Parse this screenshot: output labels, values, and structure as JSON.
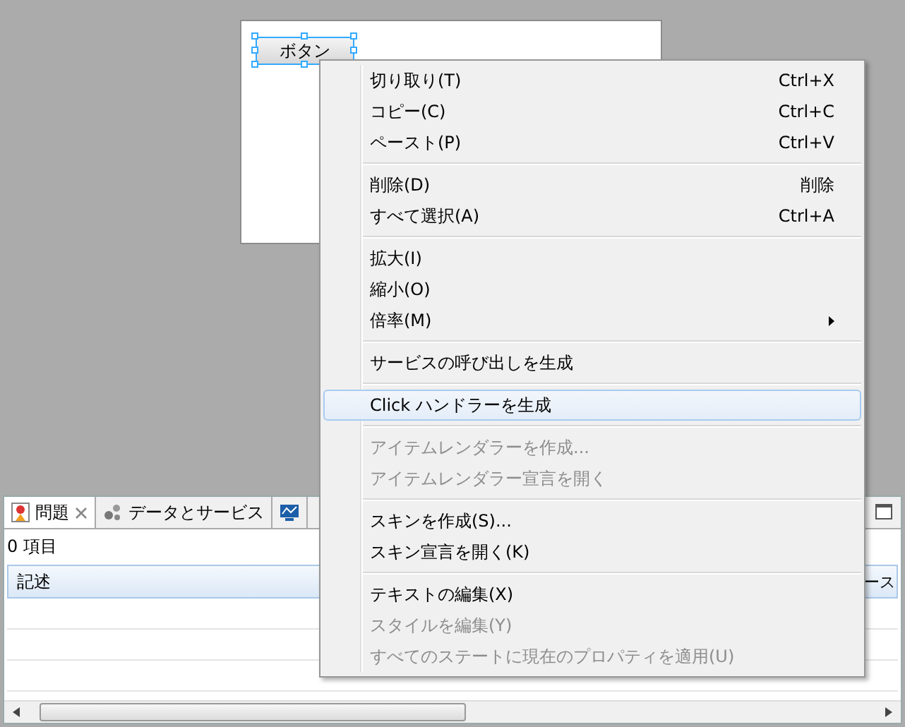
{
  "design": {
    "button": {
      "label": "ボタン",
      "selected": true
    }
  },
  "context_menu": {
    "groups": [
      [
        {
          "label": "切り取り(T)",
          "shortcut": "Ctrl+X",
          "disabled": false,
          "selected": false
        },
        {
          "label": "コピー(C)",
          "shortcut": "Ctrl+C",
          "disabled": false,
          "selected": false
        },
        {
          "label": "ペースト(P)",
          "shortcut": "Ctrl+V",
          "disabled": false,
          "selected": false
        }
      ],
      [
        {
          "label": "削除(D)",
          "shortcut": "削除",
          "disabled": false,
          "selected": false
        },
        {
          "label": "すべて選択(A)",
          "shortcut": "Ctrl+A",
          "disabled": false,
          "selected": false
        }
      ],
      [
        {
          "label": "拡大(I)",
          "disabled": false,
          "selected": false
        },
        {
          "label": "縮小(O)",
          "disabled": false,
          "selected": false
        },
        {
          "label": "倍率(M)",
          "disabled": false,
          "selected": false,
          "has_submenu": true
        }
      ],
      [
        {
          "label": "サービスの呼び出しを生成",
          "disabled": false,
          "selected": false
        }
      ],
      [
        {
          "label": "Click ハンドラーを生成",
          "disabled": false,
          "selected": true
        }
      ],
      [
        {
          "label": "アイテムレンダラーを作成...",
          "disabled": true,
          "selected": false
        },
        {
          "label": "アイテムレンダラー宣言を開く",
          "disabled": true,
          "selected": false
        }
      ],
      [
        {
          "label": "スキンを作成(S)...",
          "disabled": false,
          "selected": false
        },
        {
          "label": "スキン宣言を開く(K)",
          "disabled": false,
          "selected": false
        }
      ],
      [
        {
          "label": "テキストの編集(X)",
          "disabled": false,
          "selected": false
        },
        {
          "label": "スタイルを編集(Y)",
          "disabled": true,
          "selected": false
        },
        {
          "label": "すべてのステートに現在のプロパティを適用(U)",
          "disabled": true,
          "selected": false
        }
      ]
    ]
  },
  "panel": {
    "tabs": [
      {
        "kind": "problems",
        "label": "問題",
        "selected": true,
        "closable": true
      },
      {
        "kind": "services",
        "label": "データとサービス",
        "selected": false,
        "closable": false
      },
      {
        "kind": "monitor",
        "selected": false,
        "closable": false
      }
    ],
    "item_count": "0 項目",
    "table": {
      "columns": [
        "記述",
        "ース"
      ]
    }
  }
}
